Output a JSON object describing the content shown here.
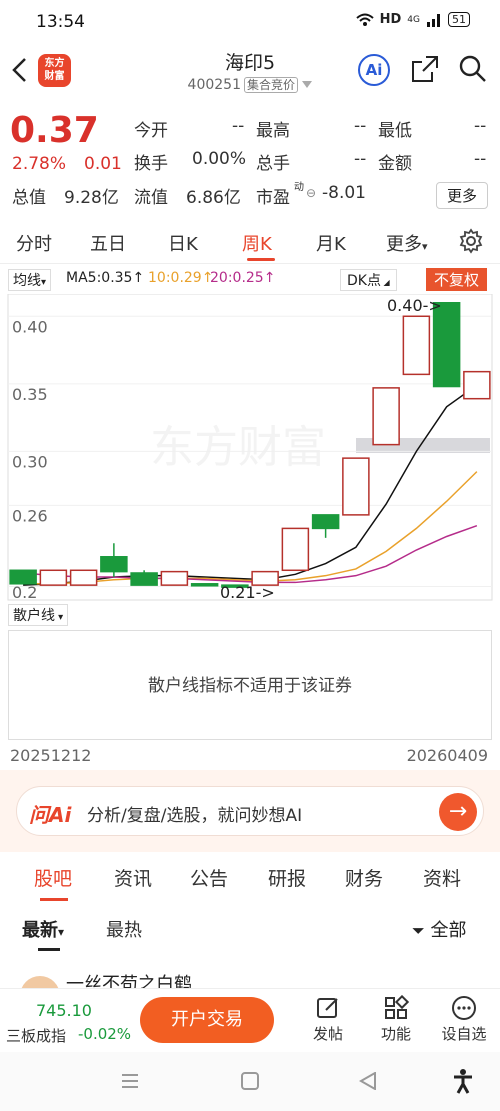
{
  "status": {
    "time": "13:54",
    "network": "HD",
    "signal": "4G",
    "battery": "51"
  },
  "header": {
    "title": "海印5",
    "code": "400251",
    "tag": "集合竞价",
    "logo": "东方\n财富",
    "ai_label": "Ai"
  },
  "quote": {
    "price": "0.37",
    "pct": "2.78%",
    "change": "0.01",
    "row1": [
      {
        "label": "今开",
        "value": "--"
      },
      {
        "label": "最高",
        "value": "--"
      },
      {
        "label": "最低",
        "value": "--"
      }
    ],
    "row2": [
      {
        "label": "换手",
        "value": "0.00%"
      },
      {
        "label": "总手",
        "value": "--"
      },
      {
        "label": "金额",
        "value": "--"
      }
    ],
    "row3": [
      {
        "label": "总值",
        "value": "9.28亿"
      },
      {
        "label": "流值",
        "value": "6.86亿"
      },
      {
        "label": "市盈",
        "sup": "动",
        "value": "-8.01"
      }
    ],
    "more": "更多"
  },
  "tabs": [
    "分时",
    "五日",
    "日K",
    "周K",
    "月K",
    "更多"
  ],
  "indicator": {
    "select": "均线",
    "ma5": "MA5:0.35↑",
    "ma10": "10:0.29↑",
    "ma20": "20:0.25↑",
    "dk": "DK点",
    "fq": "不复权"
  },
  "chart_data": {
    "type": "candlestick",
    "y_ticks": [
      "0.40",
      "0.35",
      "0.30",
      "0.26",
      "0.2"
    ],
    "ylim": [
      0.19,
      0.415
    ],
    "annotations": [
      "0.40->",
      "0.21->"
    ],
    "watermark": "东方财富",
    "colors": {
      "up": "#b5312b",
      "down": "#1a9a3c",
      "ma5": "#111111",
      "ma10": "#e9a12b",
      "ma20": "#b52c8a"
    },
    "candles": [
      {
        "o": 0.202,
        "c": 0.212,
        "h": 0.212,
        "l": 0.202,
        "dir": "down"
      },
      {
        "o": 0.201,
        "c": 0.212,
        "h": 0.212,
        "l": 0.201,
        "dir": "up"
      },
      {
        "o": 0.201,
        "c": 0.212,
        "h": 0.212,
        "l": 0.201,
        "dir": "up"
      },
      {
        "o": 0.211,
        "c": 0.222,
        "h": 0.232,
        "l": 0.207,
        "dir": "down"
      },
      {
        "o": 0.201,
        "c": 0.21,
        "h": 0.212,
        "l": 0.201,
        "dir": "down"
      },
      {
        "o": 0.201,
        "c": 0.211,
        "h": 0.211,
        "l": 0.201,
        "dir": "up"
      },
      {
        "o": 0.201,
        "c": 0.202,
        "h": 0.202,
        "l": 0.2,
        "dir": "down"
      },
      {
        "o": 0.2,
        "c": 0.201,
        "h": 0.201,
        "l": 0.2,
        "dir": "down"
      },
      {
        "o": 0.201,
        "c": 0.211,
        "h": 0.211,
        "l": 0.201,
        "dir": "up"
      },
      {
        "o": 0.212,
        "c": 0.243,
        "h": 0.243,
        "l": 0.212,
        "dir": "up"
      },
      {
        "o": 0.253,
        "c": 0.243,
        "h": 0.253,
        "l": 0.236,
        "dir": "down"
      },
      {
        "o": 0.253,
        "c": 0.295,
        "h": 0.295,
        "l": 0.253,
        "dir": "up"
      },
      {
        "o": 0.305,
        "c": 0.347,
        "h": 0.347,
        "l": 0.305,
        "dir": "up"
      },
      {
        "o": 0.357,
        "c": 0.4,
        "h": 0.4,
        "l": 0.357,
        "dir": "up"
      },
      {
        "o": 0.41,
        "c": 0.348,
        "h": 0.41,
        "l": 0.348,
        "dir": "down"
      },
      {
        "o": 0.339,
        "c": 0.359,
        "h": 0.359,
        "l": 0.339,
        "dir": "up"
      }
    ],
    "ma5": [
      0.201,
      0.202,
      0.204,
      0.207,
      0.208,
      0.208,
      0.207,
      0.206,
      0.205,
      0.209,
      0.217,
      0.229,
      0.261,
      0.3,
      0.333,
      0.349
    ],
    "ma10": [
      0.202,
      0.202,
      0.203,
      0.205,
      0.206,
      0.206,
      0.206,
      0.205,
      0.204,
      0.205,
      0.208,
      0.213,
      0.226,
      0.243,
      0.263,
      0.285
    ],
    "ma20": [
      0.21,
      0.208,
      0.207,
      0.207,
      0.206,
      0.206,
      0.205,
      0.204,
      0.203,
      0.203,
      0.205,
      0.208,
      0.215,
      0.227,
      0.237,
      0.245
    ]
  },
  "sanhu": {
    "label": "散户线",
    "message": "散户线指标不适用于该证券"
  },
  "dates": {
    "start": "20251212",
    "end": "20260409"
  },
  "ai": {
    "logo": "问Ai",
    "text": "分析/复盘/选股，就问妙想AI",
    "go": "→"
  },
  "bottom_tabs": [
    "股吧",
    "资讯",
    "公告",
    "研报",
    "财务",
    "资料"
  ],
  "sort": {
    "newest": "最新",
    "hottest": "最热",
    "all": "全部"
  },
  "post_peek": "一丝不苟之白鹤",
  "bottom_bar": {
    "index_value": "745.10",
    "index_name": "三板成指",
    "index_change": "-0.02%",
    "trade": "开户交易",
    "post": "发帖",
    "func": "功能",
    "watch": "设自选"
  }
}
